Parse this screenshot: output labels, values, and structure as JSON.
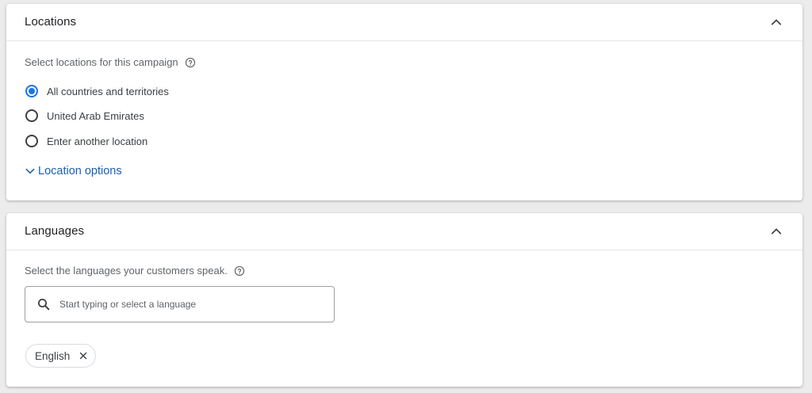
{
  "locations": {
    "title": "Locations",
    "subtitle": "Select locations for this campaign",
    "options": [
      {
        "label": "All countries and territories",
        "checked": true
      },
      {
        "label": "United Arab Emirates",
        "checked": false
      },
      {
        "label": "Enter another location",
        "checked": false
      }
    ],
    "more_link": "Location options"
  },
  "languages": {
    "title": "Languages",
    "subtitle": "Select the languages your customers speak.",
    "search_placeholder": "Start typing or select a language",
    "selected": [
      {
        "label": "English"
      }
    ]
  },
  "icons": {
    "collapse": "chevron-up-icon",
    "help": "help-circle-icon",
    "expand": "chevron-down-icon",
    "search": "search-icon",
    "remove": "close-icon"
  },
  "colors": {
    "accent": "#1a73e8",
    "link": "#1a5fb4"
  }
}
